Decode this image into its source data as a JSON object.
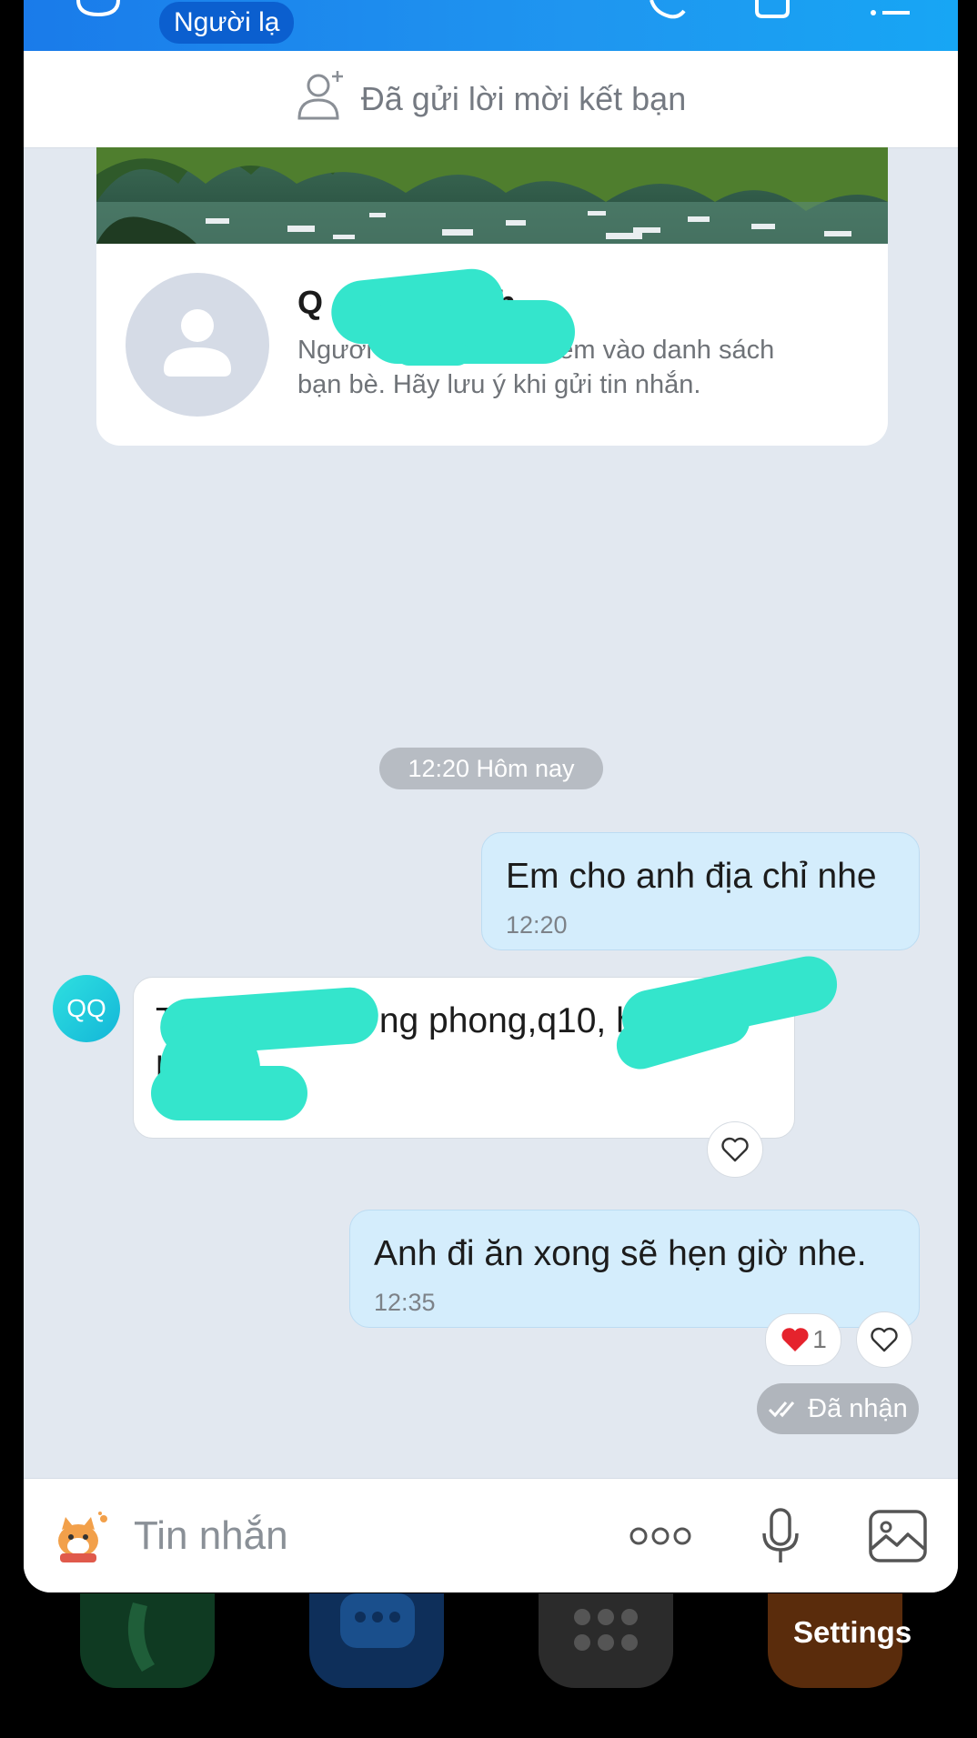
{
  "header": {
    "stranger_badge": "Người lạ",
    "icons": [
      "chat-bubble-icon",
      "phone-icon",
      "video-call-icon",
      "menu-icon"
    ]
  },
  "friend_request": {
    "status_text": "Đã gửi lời mời kết bạn",
    "icon": "add-friend-icon"
  },
  "profile_card": {
    "name_visible": "Q",
    "name_visible_tail": "h",
    "note_part1": "Người",
    "note_part2": "được thêm vào danh sách",
    "note_line2": "bạn bè. Hãy lưu ý khi gửi tin nhắn."
  },
  "chat": {
    "date_separator": "12:20 Hôm nay",
    "messages": [
      {
        "direction": "outgoing",
        "text": "Em cho anh địa chỉ nhe",
        "time": "12:20"
      },
      {
        "direction": "incoming",
        "sender_initials": "QQ",
        "text_visible_start": "T",
        "text_visible_mid": "ng phong,q10, h",
        "text_visible_line2": "h",
        "time": ""
      },
      {
        "direction": "outgoing",
        "text": "Anh đi ăn xong sẽ hẹn giờ nhe.",
        "time": "12:35",
        "reaction_count": "1"
      }
    ],
    "delivery_status": "Đã nhận"
  },
  "composer": {
    "placeholder": "Tin nhắn",
    "icons": [
      "sticker-icon",
      "more-icon",
      "microphone-icon",
      "image-icon"
    ]
  },
  "background": {
    "settings_label": "Settings"
  },
  "colors": {
    "header_blue": "#1a7bea",
    "outgoing_bubble": "#d4edfc",
    "chat_background": "#e2e8f0",
    "redaction": "#34e5cc"
  }
}
